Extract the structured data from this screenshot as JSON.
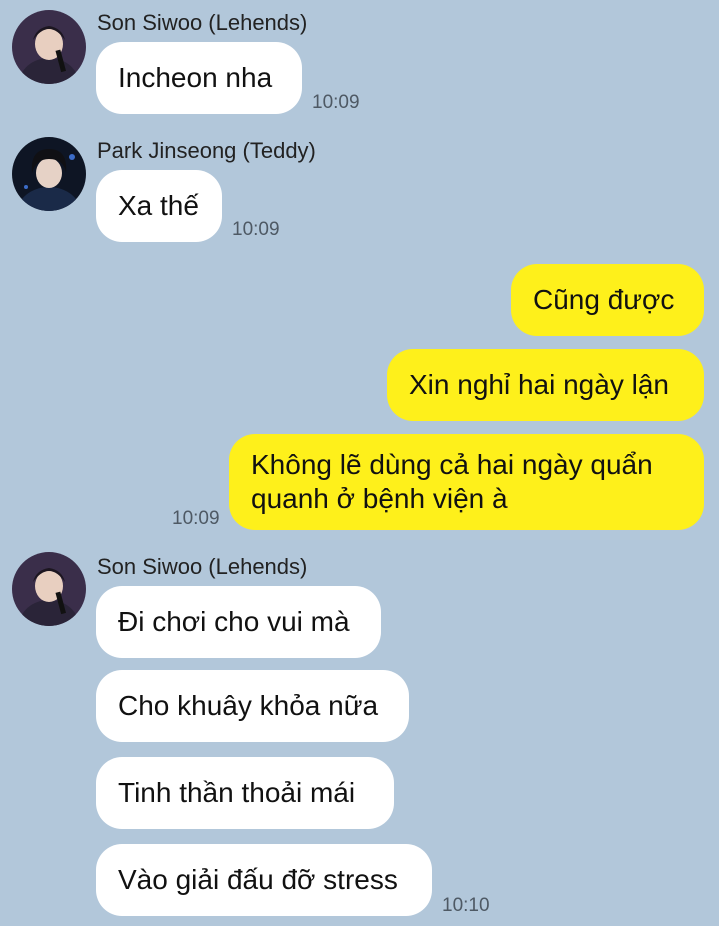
{
  "colors": {
    "background": "#b2c7da",
    "incoming_bubble": "#ffffff",
    "outgoing_bubble": "#fef01b",
    "timestamp": "#4e5964"
  },
  "messages": {
    "group1": {
      "sender": "Son Siwoo (Lehends)",
      "text": "Incheon nha",
      "time": "10:09"
    },
    "group2": {
      "sender": "Park Jinseong (Teddy)",
      "text": "Xa thế",
      "time": "10:09"
    },
    "outgoing": {
      "line1": "Cũng được",
      "line2": "Xin nghỉ hai ngày lận",
      "line3": "Không lẽ dùng cả hai ngày quẩn quanh ở bệnh viện à",
      "time": "10:09"
    },
    "group3": {
      "sender": "Son Siwoo (Lehends)",
      "line1": "Đi chơi cho vui mà",
      "line2": "Cho khuây khỏa nữa",
      "line3": "Tinh thần thoải mái",
      "line4": "Vào giải đấu đỡ stress",
      "time": "10:10"
    }
  }
}
